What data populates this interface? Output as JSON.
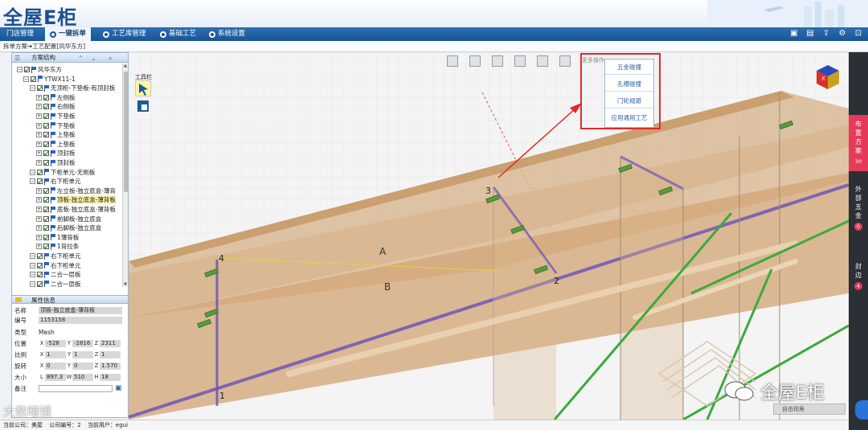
{
  "header": {
    "logo_text": "全屋E柜"
  },
  "nav": {
    "tabs": [
      {
        "label": "门店管理",
        "active": false
      },
      {
        "label": "一键拆单",
        "active": true
      },
      {
        "label": "工艺库管理",
        "active": false
      },
      {
        "label": "基础工艺",
        "active": false
      },
      {
        "label": "系统设置",
        "active": false
      }
    ],
    "right_icons": [
      "image-icon",
      "save-icon",
      "export-icon",
      "settings-icon",
      "logout-icon"
    ]
  },
  "breadcrumb": "拆单方案➔工艺配置[风华东方]",
  "left_panel": {
    "title": "方案结构",
    "tree": [
      {
        "label": "风华东方",
        "level": 0
      },
      {
        "label": "YTWX11-1",
        "level": 1
      },
      {
        "label": "无顶柜-下垫板-有顶封板",
        "level": 2
      },
      {
        "label": "左侧板",
        "level": 3
      },
      {
        "label": "右侧板",
        "level": 3
      },
      {
        "label": "下垫板",
        "level": 3
      },
      {
        "label": "下垫板",
        "level": 3
      },
      {
        "label": "上垫板",
        "level": 3
      },
      {
        "label": "上垫板",
        "level": 3
      },
      {
        "label": "顶封板",
        "level": 3
      },
      {
        "label": "顶封板",
        "level": 3
      },
      {
        "label": "下柜单元-无侧板",
        "level": 2
      },
      {
        "label": "右下柜单元",
        "level": 2
      },
      {
        "label": "左立板-独立底盒-薄背",
        "level": 3
      },
      {
        "label": "顶板-独立底盒-薄背板",
        "level": 3,
        "selected": true
      },
      {
        "label": "底板-独立底盒-薄背板",
        "level": 3
      },
      {
        "label": "前脚板-独立底盒",
        "level": 3
      },
      {
        "label": "后脚板-独立底盒",
        "level": 3
      },
      {
        "label": "1薄背板",
        "level": 3
      },
      {
        "label": "1背拉条",
        "level": 3
      },
      {
        "label": "右下柜单元",
        "level": 2
      },
      {
        "label": "右下柜单元",
        "level": 2
      },
      {
        "label": "二合一层板",
        "level": 2
      },
      {
        "label": "二合一层板",
        "level": 2
      }
    ]
  },
  "properties": {
    "title": "属性信息",
    "name_label": "名称",
    "name_value": "顶板-独立底盒-薄背板",
    "code_label": "编号",
    "code_value": "1153158",
    "type_label": "类型",
    "type_value": "Mesh",
    "position_label": "位置",
    "position": {
      "x": "-528",
      "y": "-2816",
      "z": "2311"
    },
    "scale_label": "比例",
    "scale": {
      "x": "1",
      "y": "1",
      "z": "1"
    },
    "rotation_label": "旋转",
    "rotation": {
      "x": "0",
      "y": "0",
      "z": "1.570"
    },
    "size_label": "大小",
    "size": {
      "l": "897.3",
      "w": "510",
      "h": "18"
    },
    "note_label": "备注",
    "note_value": ""
  },
  "viewport": {
    "toolbar_more": "更多操作",
    "tool_label": "工具栏",
    "menu": [
      "五金碰撞",
      "孔槽碰撞",
      "门轮规避",
      "应用通用工艺"
    ],
    "labels": {
      "A": "A",
      "B": "B",
      "n1": "1",
      "n2": "2",
      "n3": "3",
      "n4": "4"
    },
    "view_button": "自由视角"
  },
  "right_tabs": [
    {
      "label": "布置方案",
      "count": "30",
      "active": true
    },
    {
      "label": "外部五金",
      "count": "0",
      "active": false
    },
    {
      "label": "封边",
      "count": "4",
      "active": false
    }
  ],
  "statusbar": {
    "company": "当前公司：美屋",
    "company_id": "公司编号：2",
    "user": "当前用户：egui"
  },
  "watermarks": {
    "left": "大数暗镜",
    "right": "全屋E柜"
  },
  "colors": {
    "nav_blue": "#1a5595",
    "panel_fill": "#d9b48a",
    "green_rod": "#3caa3c",
    "purple_edge": "#6e56b8",
    "highlight_red": "#e12a2a",
    "tab_active": "#e63a5a"
  }
}
